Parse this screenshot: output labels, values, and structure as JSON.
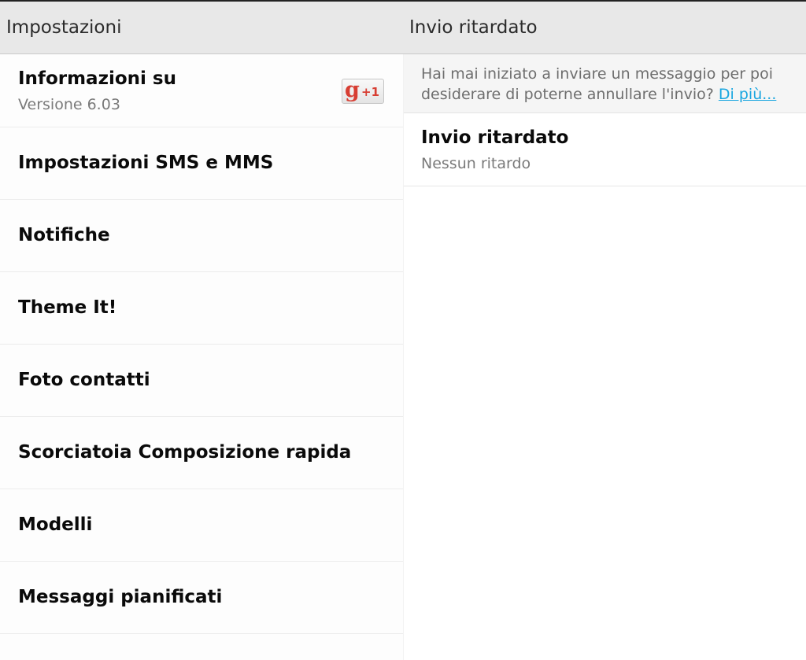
{
  "header": {
    "left_title": "Impostazioni",
    "right_title": "Invio ritardato"
  },
  "settings_list": [
    {
      "title": "Informazioni su",
      "subtitle": "Versione 6.03",
      "badge": {
        "icon": "google-plus-one-icon",
        "glyph": "g",
        "label": "+1"
      }
    },
    {
      "title": "Impostazioni SMS e MMS"
    },
    {
      "title": "Notifiche"
    },
    {
      "title": "Theme It!"
    },
    {
      "title": "Foto contatti"
    },
    {
      "title": "Scorciatoia Composizione rapida"
    },
    {
      "title": "Modelli"
    },
    {
      "title": "Messaggi pianificati"
    }
  ],
  "detail": {
    "info_line1": "Hai mai iniziato a inviare un messaggio per poi",
    "info_line2": "desiderare di poterne annullare l'invio?",
    "info_link": "Di più...",
    "pref_title": "Invio ritardato",
    "pref_value": "Nessun ritardo"
  },
  "colors": {
    "header_bg": "#e8e8e8",
    "link": "#1aa6e0",
    "gplus_red": "#d73d32"
  }
}
